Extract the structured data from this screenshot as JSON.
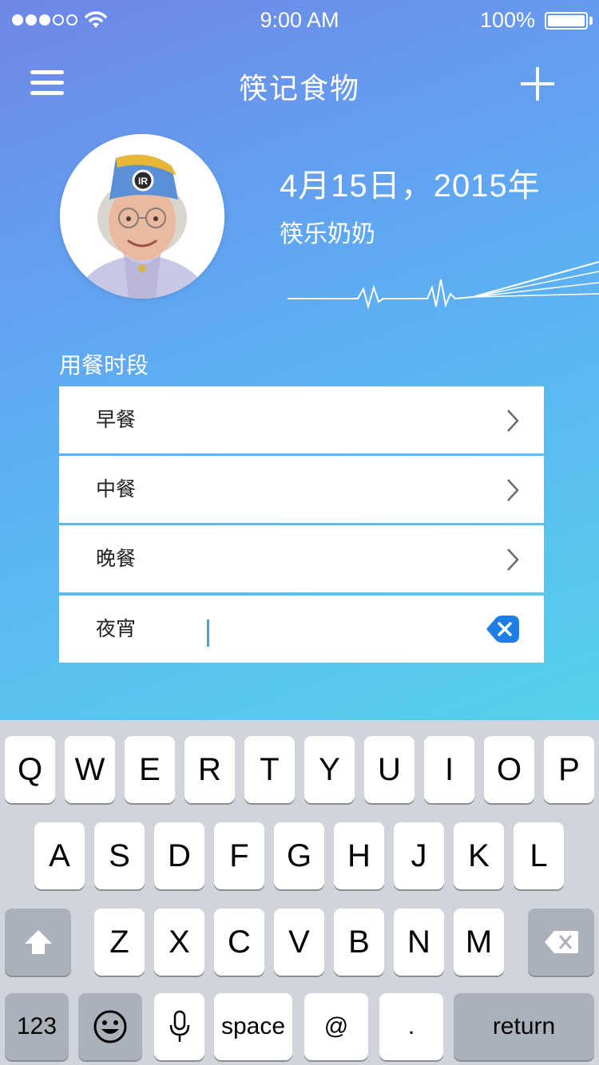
{
  "status_bar": {
    "time": "9:00 AM",
    "battery_text": "100%",
    "signal_bars_filled": 3,
    "signal_bars_total": 5,
    "battery_level": 1.0
  },
  "nav": {
    "title": "筷记食物",
    "menu_icon": "hamburger-menu-icon",
    "add_icon": "plus-icon"
  },
  "profile": {
    "date": "4月15日，2015年",
    "name": "筷乐奶奶"
  },
  "meals": {
    "section_label": "用餐时段",
    "items": [
      {
        "label": "早餐",
        "icon": "chevron-right-icon"
      },
      {
        "label": "中餐",
        "icon": "chevron-right-icon"
      },
      {
        "label": "晚餐",
        "icon": "chevron-right-icon"
      },
      {
        "label": "夜宵",
        "icon": "clear-icon"
      }
    ]
  },
  "keyboard": {
    "row1": [
      "Q",
      "W",
      "E",
      "R",
      "T",
      "Y",
      "U",
      "I",
      "O",
      "P"
    ],
    "row2": [
      "A",
      "S",
      "D",
      "F",
      "G",
      "H",
      "J",
      "K",
      "L"
    ],
    "row3": [
      "Z",
      "X",
      "C",
      "V",
      "B",
      "N",
      "M"
    ],
    "numbers_key": "123",
    "space_key": "space",
    "at_key": "@",
    "period_key": ".",
    "return_key": "return",
    "colors": {
      "background": "#d1d5db",
      "key": "#ffffff",
      "dark_key": "#abb1ba"
    }
  },
  "colors": {
    "gradient_top": "#6f86e6",
    "gradient_bottom": "#52e4df",
    "accent": "#3ea3e8",
    "clear_button": "#1e7de6"
  }
}
